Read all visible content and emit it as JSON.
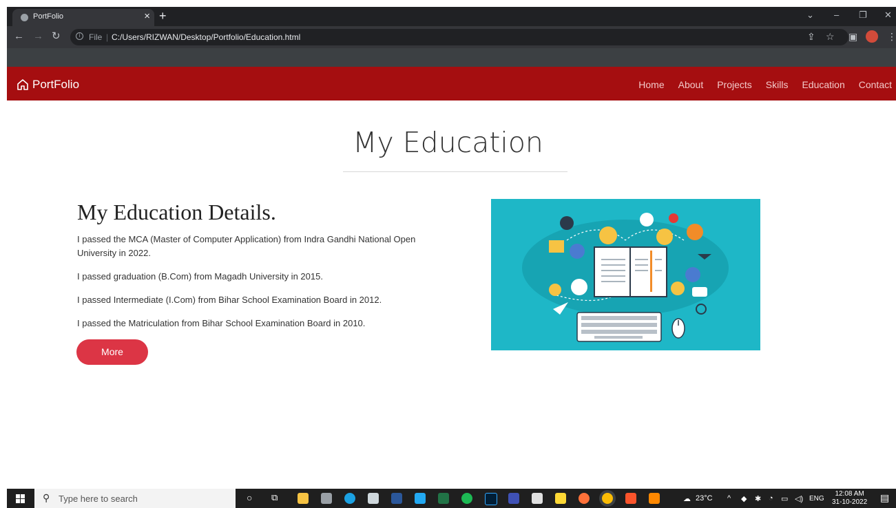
{
  "browser": {
    "tab_title": "PortFolio",
    "tab_close": "×",
    "new_tab": "+",
    "address_label": "File",
    "address_sep": "|",
    "url": "C:/Users/RIZWAN/Desktop/Portfolio/Education.html"
  },
  "site": {
    "brand": "PortFolio",
    "nav": [
      "Home",
      "About",
      "Projects",
      "Skills",
      "Education",
      "Contact"
    ]
  },
  "page": {
    "heading": "My Education",
    "details_title": "My Education Details.",
    "paragraphs": [
      "I passed the MCA (Master of Computer Application) from Indra Gandhi National Open University in 2022.",
      "I passed graduation (B.Com) from Magadh University in 2015.",
      "I passed Intermediate (I.Com) from Bihar School Examination Board in 2012.",
      "I passed the Matriculation from Bihar School Examination Board in 2010."
    ],
    "more_button": "More"
  },
  "taskbar": {
    "search_placeholder": "Type here to search",
    "weather": "23°C",
    "language": "ENG",
    "time": "12:08 AM",
    "date": "31-10-2022"
  },
  "colors": {
    "nav_bg": "#a50e10",
    "button": "#dc3545",
    "illustration_bg": "#1eb7c7"
  }
}
